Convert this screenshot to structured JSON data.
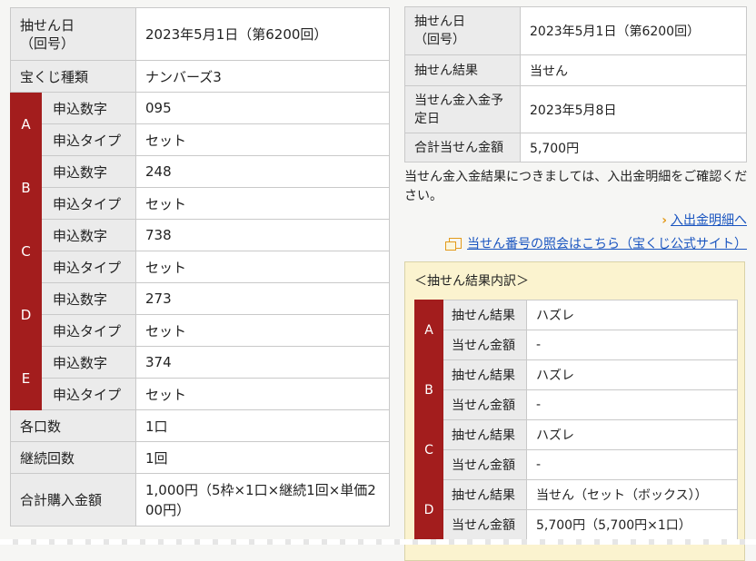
{
  "purchase": {
    "draw_date_label_1": "抽せん日",
    "draw_date_label_2": "（回号）",
    "draw_date_value": "2023年5月1日（第6200回）",
    "type_label": "宝くじ種類",
    "type_value": "ナンバーズ3",
    "number_label": "申込数字",
    "apply_type_label": "申込タイプ",
    "entries": [
      {
        "letter": "A",
        "number": "095",
        "apply_type": "セット"
      },
      {
        "letter": "B",
        "number": "248",
        "apply_type": "セット"
      },
      {
        "letter": "C",
        "number": "738",
        "apply_type": "セット"
      },
      {
        "letter": "D",
        "number": "273",
        "apply_type": "セット"
      },
      {
        "letter": "E",
        "number": "374",
        "apply_type": "セット"
      }
    ],
    "units_label": "各口数",
    "units_value": "1口",
    "continue_label": "継続回数",
    "continue_value": "1回",
    "total_label": "合計購入金額",
    "total_value_1": "1,000円（5枠×1口×継続1回×単価2",
    "total_value_2": "00円）"
  },
  "result_info": {
    "draw_date_label_1": "抽せん日",
    "draw_date_label_2": "（回号）",
    "draw_date_value": "2023年5月1日（第6200回）",
    "result_label": "抽せん結果",
    "result_value": "当せん",
    "deposit_label_1": "当せん金入金予",
    "deposit_label_2": "定日",
    "deposit_value": "2023年5月8日",
    "total_label": "合計当せん金額",
    "total_value": "5,700円"
  },
  "note_line1": "当せん金入金結果につきましては、入出金明細をご確認くだ",
  "note_line2": "さい。",
  "links": {
    "statement": "入出金明細へ",
    "official": "当せん番号の照会はこちら（宝くじ公式サイト）"
  },
  "breakdown": {
    "title": "＜抽せん結果内訳＞",
    "result_label": "抽せん結果",
    "amount_label": "当せん金額",
    "rows": [
      {
        "letter": "A",
        "result": "ハズレ",
        "amount": "-"
      },
      {
        "letter": "B",
        "result": "ハズレ",
        "amount": "-"
      },
      {
        "letter": "C",
        "result": "ハズレ",
        "amount": "-"
      },
      {
        "letter": "D",
        "result": "当せん（セット（ボックス））",
        "amount": "5,700円（5,700円×1口）"
      }
    ]
  },
  "colors": {
    "accent_red": "#a31d1d",
    "link_blue": "#1a55c0",
    "chevron_orange": "#e39a1a",
    "panel_yellow": "#fbf3cf"
  }
}
